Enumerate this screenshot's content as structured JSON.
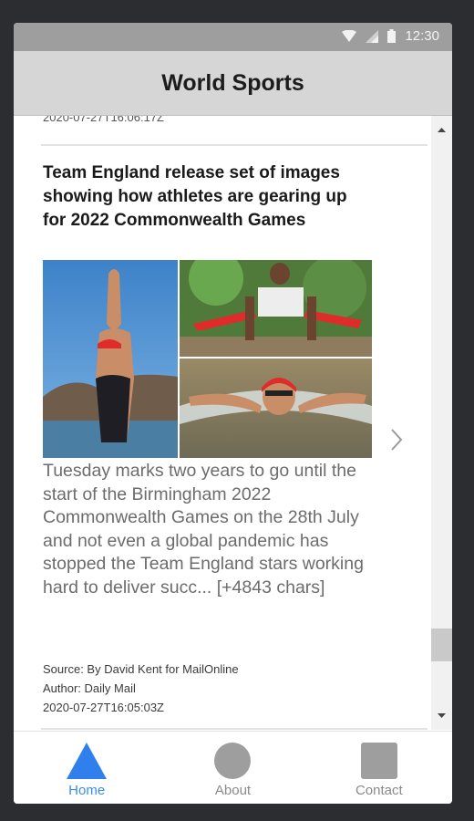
{
  "status_bar": {
    "time": "12:30",
    "icons": [
      "wifi-icon",
      "signal-icon",
      "battery-icon"
    ]
  },
  "app_bar": {
    "title": "World Sports"
  },
  "previous_article": {
    "date": "2020-07-27T16:06:17Z"
  },
  "article": {
    "title": "Team England release set of images showing how athletes are gearing up for 2022 Commonwealth Games",
    "description": "Tuesday marks two years to go until the start of the Birmingham 2022 Commonwealth Games on the 28th July and not even a global pandemic has stopped the Team England stars working hard to deliver succ... [+4843 chars]",
    "source": "Source: By David Kent for MailOnline",
    "author": "Author: Daily Mail",
    "published_at": "2020-07-27T16:05:03Z",
    "image_alt": "athlete photo collage",
    "next_icon": "chevron-right-icon"
  },
  "bottom_nav": {
    "items": [
      {
        "label": "Home",
        "icon": "triangle-icon",
        "active": true,
        "color": "#2f80ed"
      },
      {
        "label": "About",
        "icon": "circle-icon",
        "active": false,
        "color": "#9e9e9e"
      },
      {
        "label": "Contact",
        "icon": "square-icon",
        "active": false,
        "color": "#9e9e9e"
      }
    ]
  },
  "colors": {
    "status_bar": "#9e9e9e",
    "app_bar": "#d6d6d6",
    "accent": "#2f80ed"
  }
}
